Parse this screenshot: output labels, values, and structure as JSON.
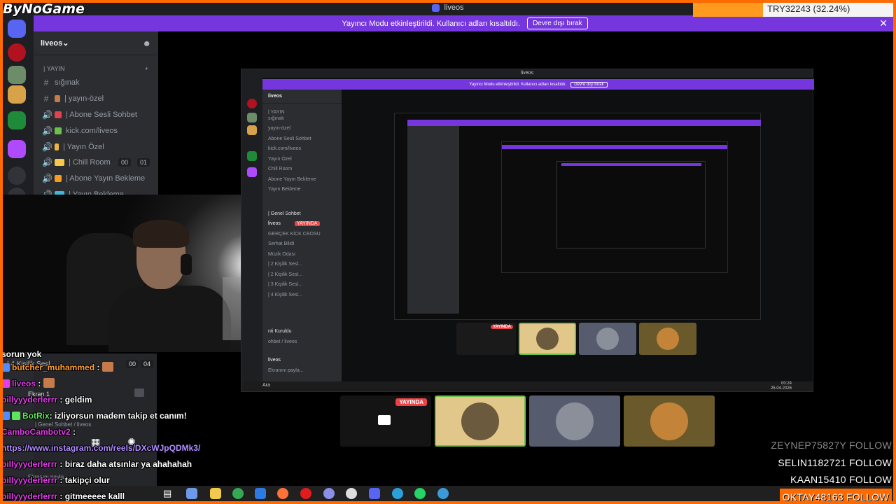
{
  "window": {
    "title": "liveos"
  },
  "overlay": {
    "brand": "ByNoGame",
    "ticker_text": "TRY32243 (32.24%)"
  },
  "banner": {
    "text": "Yayıncı Modu etkinleştirildi. Kullanıcı adları kısaltıldı.",
    "button": "Devre dışı bırak",
    "close": "✕"
  },
  "server": {
    "name": "liveos",
    "category": "YAYIN",
    "channels": [
      {
        "label": "sığınak",
        "type": "text"
      },
      {
        "label": "| yayın-özel",
        "type": "text"
      },
      {
        "label": "| Abone Sesli Sohbet",
        "type": "voice"
      },
      {
        "label": "kick.com/liveos",
        "type": "voice"
      },
      {
        "label": "| Yayın Özel",
        "type": "voice"
      },
      {
        "label": "| Chill Room",
        "type": "voice",
        "badge1": "00",
        "badge2": "01"
      },
      {
        "label": "| Abone Yayın Bekleme",
        "type": "voice"
      },
      {
        "label": "| Yayın Bekleme",
        "type": "voice"
      }
    ],
    "hidden_channel": {
      "label": "| 4 Kişilik Sesl...",
      "badge1": "00",
      "badge2": "04"
    }
  },
  "voice_panel": {
    "screen_label": "Ekran 1",
    "channel_label": "| Genel Sohbet / liveos",
    "sharing_label": "Ekranını payla..."
  },
  "shared_screen": {
    "title": "liveos",
    "banner": "Yayıncı Modu etkinleştirildi. Kullanıcı adları kısaltıldı.",
    "banner_button": "Devre dışı bırak",
    "server_name": "liveos",
    "channels": [
      "sığınak",
      "yayın-özel",
      "Abone Sesli Sohbet",
      "kick.com/liveos",
      "Yayın Özel",
      "Chill Room",
      "Abone Yayın Bekleme",
      "Yayın Bekleme"
    ],
    "voice_channel": "| Genel Sohbet",
    "voice_users": [
      "liveos",
      "GERÇEK KİCK CEOSU",
      "Serhat Bilidi",
      "Müzik Odası",
      "| 2 Kişilik Sesl...",
      "| 2 Kişilik Sesl...",
      "| 3 Kişilik Sesl...",
      "| 4 Kişilik Sesl..."
    ],
    "live_badge": "YAYINDA",
    "bottom_user": "liveos",
    "bottom_sub": "Ekranını payla...",
    "call_label": "nti Kuruldu",
    "call_sub": "ohbet / liveos",
    "search": "Ara",
    "clock_time": "00:24",
    "clock_date": "25.04.2026"
  },
  "stream_tiles": {
    "live_badge": "YAYINDA"
  },
  "chat": [
    {
      "user": "",
      "text": "sorun yok"
    },
    {
      "user": "butcher_muhammed",
      "text": ":"
    },
    {
      "user": "liveos",
      "text": ":"
    },
    {
      "user": "billyyyderlerrr",
      "text": ": geldim"
    },
    {
      "user": "BotRix",
      "text": ": izliyorsun madem takip et canım!"
    },
    {
      "user": "CamboCambotv2",
      "text": ":"
    },
    {
      "user": "",
      "text": "https://www.instagram.com/reels/DXcWJpQDMk3/"
    },
    {
      "user": "billyyyderlerrr",
      "text": ": biraz daha atsınlar ya ahahahah"
    },
    {
      "user": "billyyyderlerrr",
      "text": ": takipçi olur"
    },
    {
      "user": "billyyyderlerrr",
      "text": ": gitmeeeee kalll"
    }
  ],
  "followers": [
    {
      "name": "ZEYNEP75827Y",
      "action": "FOLLOW"
    },
    {
      "name": "SELIN1182721",
      "action": "FOLLOW"
    },
    {
      "name": "KAAN15410",
      "action": "FOLLOW"
    },
    {
      "name": "OKTAY48163",
      "action": "FOLLOW"
    }
  ],
  "colors": {
    "accent": "#7636de",
    "overlay_orange": "#ff6a00",
    "live_red": "#ed4245",
    "discord_bg": "#2b2d31"
  }
}
